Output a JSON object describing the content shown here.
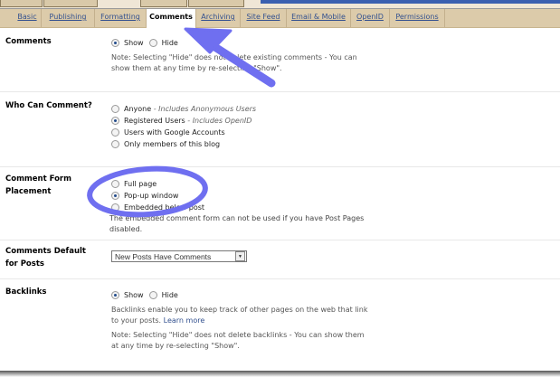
{
  "tabs": [
    "Basic",
    "Publishing",
    "Formatting",
    "Comments",
    "Archiving",
    "Site Feed",
    "Email & Mobile",
    "OpenID",
    "Permissions"
  ],
  "active_tab": "Comments",
  "sections": {
    "comments": {
      "label": "Comments",
      "options": [
        "Show",
        "Hide"
      ],
      "selected": "Show",
      "note": "Note: Selecting \"Hide\" does not delete existing comments - You can show them at any time by re-selecting \"Show\"."
    },
    "who": {
      "label": "Who Can Comment?",
      "options": [
        {
          "label": "Anyone",
          "hint": "- Includes Anonymous Users"
        },
        {
          "label": "Registered Users",
          "hint": "- Includes OpenID"
        },
        {
          "label": "Users with Google Accounts",
          "hint": ""
        },
        {
          "label": "Only members of this blog",
          "hint": ""
        }
      ],
      "selected": "Registered Users"
    },
    "placement": {
      "label": "Comment Form Placement",
      "options": [
        "Full page",
        "Pop-up window",
        "Embedded below post"
      ],
      "selected": "Pop-up window",
      "note": "The embedded comment form can not be used if you have Post Pages disabled."
    },
    "default": {
      "label": "Comments Default for Posts",
      "value": "New Posts Have Comments"
    },
    "backlinks": {
      "label": "Backlinks",
      "options": [
        "Show",
        "Hide"
      ],
      "selected": "Show",
      "desc": "Backlinks enable you to keep track of other pages on the web that link to your posts.",
      "link": "Learn more",
      "note": "Note: Selecting \"Hide\" does not delete backlinks - You can show them at any time by re-selecting \"Show\"."
    }
  },
  "annotation_color": "#6f6ff0"
}
